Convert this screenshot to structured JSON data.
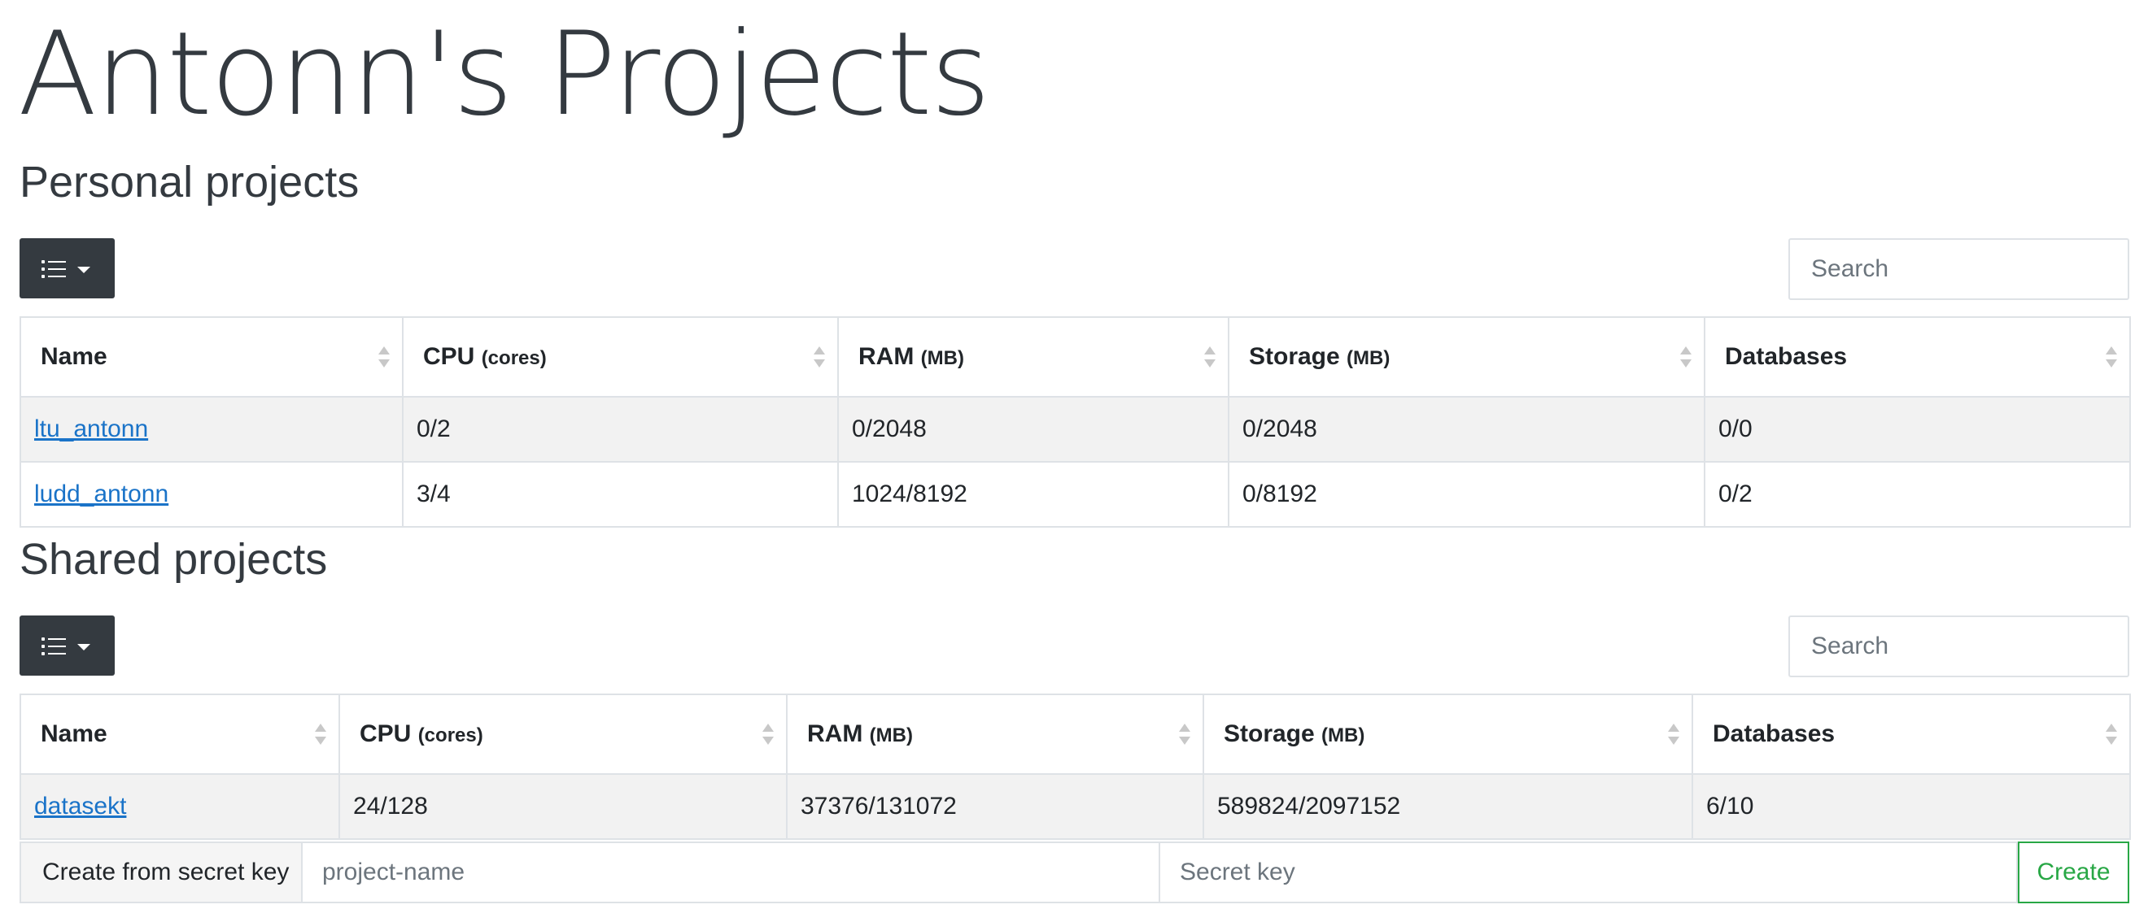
{
  "page": {
    "title": "Antonn's Projects"
  },
  "personal": {
    "heading": "Personal projects",
    "search_placeholder": "Search",
    "columns": [
      {
        "label": "Name",
        "unit": ""
      },
      {
        "label": "CPU",
        "unit": "(cores)"
      },
      {
        "label": "RAM",
        "unit": "(MB)"
      },
      {
        "label": "Storage",
        "unit": "(MB)"
      },
      {
        "label": "Databases",
        "unit": ""
      }
    ],
    "rows": [
      {
        "name": "ltu_antonn",
        "cpu": "0/2",
        "ram": "0/2048",
        "storage": "0/2048",
        "databases": "0/0"
      },
      {
        "name": "ludd_antonn",
        "cpu": "3/4",
        "ram": "1024/8192",
        "storage": "0/8192",
        "databases": "0/2"
      }
    ]
  },
  "shared": {
    "heading": "Shared projects",
    "search_placeholder": "Search",
    "columns": [
      {
        "label": "Name",
        "unit": ""
      },
      {
        "label": "CPU",
        "unit": "(cores)"
      },
      {
        "label": "RAM",
        "unit": "(MB)"
      },
      {
        "label": "Storage",
        "unit": "(MB)"
      },
      {
        "label": "Databases",
        "unit": ""
      }
    ],
    "rows": [
      {
        "name": "datasekt",
        "cpu": "24/128",
        "ram": "37376/131072",
        "storage": "589824/2097152",
        "databases": "6/10"
      }
    ]
  },
  "create": {
    "label": "Create from secret key",
    "name_placeholder": "project-name",
    "key_placeholder": "Secret key",
    "button_label": "Create"
  },
  "icons": {
    "columns_toggle": "list-icon",
    "dropdown": "caret-down-icon",
    "sort": "sort-both-icon"
  },
  "colors": {
    "toolbar_bg": "#343a40",
    "link": "#1a73c8",
    "create_accent": "#28a745",
    "stripe": "#f2f2f2"
  }
}
